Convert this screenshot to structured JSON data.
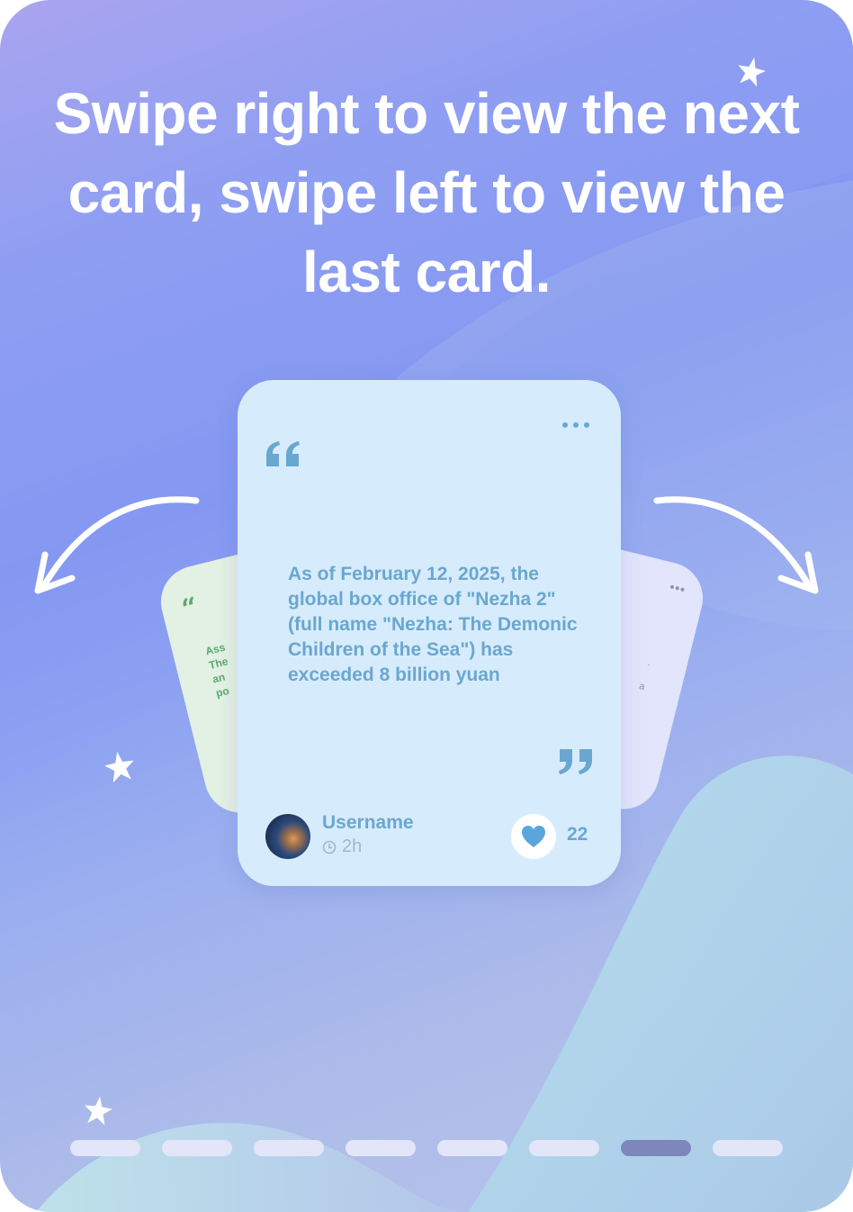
{
  "headline": "Swipe right to view the next card, swipe left to view the last card.",
  "colors": {
    "accent": "#6aa7cf",
    "card_main_bg": "#d6ecfd",
    "card_left_bg": "#e3f1e4",
    "card_right_bg": "#e2e5fb",
    "pager_inactive": "#e3e6f8",
    "pager_active": "#7f85bd"
  },
  "card_left": {
    "quote_mark": "“",
    "text_lines": [
      "Ass",
      "The",
      "an",
      "po"
    ]
  },
  "card_right": {
    "more_icon": "ellipsis-icon",
    "text_lines": [
      ".",
      "a"
    ],
    "quote_mark": "”"
  },
  "card_main": {
    "more_icon": "ellipsis-icon",
    "quote_open_icon": "quote-open-icon",
    "quote_close_icon": "quote-close-icon",
    "body": "As of February 12, 2025, the global box office of \"Nezha 2\" (full name \"Nezha: The Demonic Children of the Sea\") has exceeded 8 billion yuan",
    "author": {
      "username": "Username",
      "time_icon": "clock-icon",
      "time": "2h"
    },
    "like": {
      "icon": "heart-icon",
      "count": "22"
    }
  },
  "pager": {
    "total_pages": 8,
    "active_index": 6
  }
}
